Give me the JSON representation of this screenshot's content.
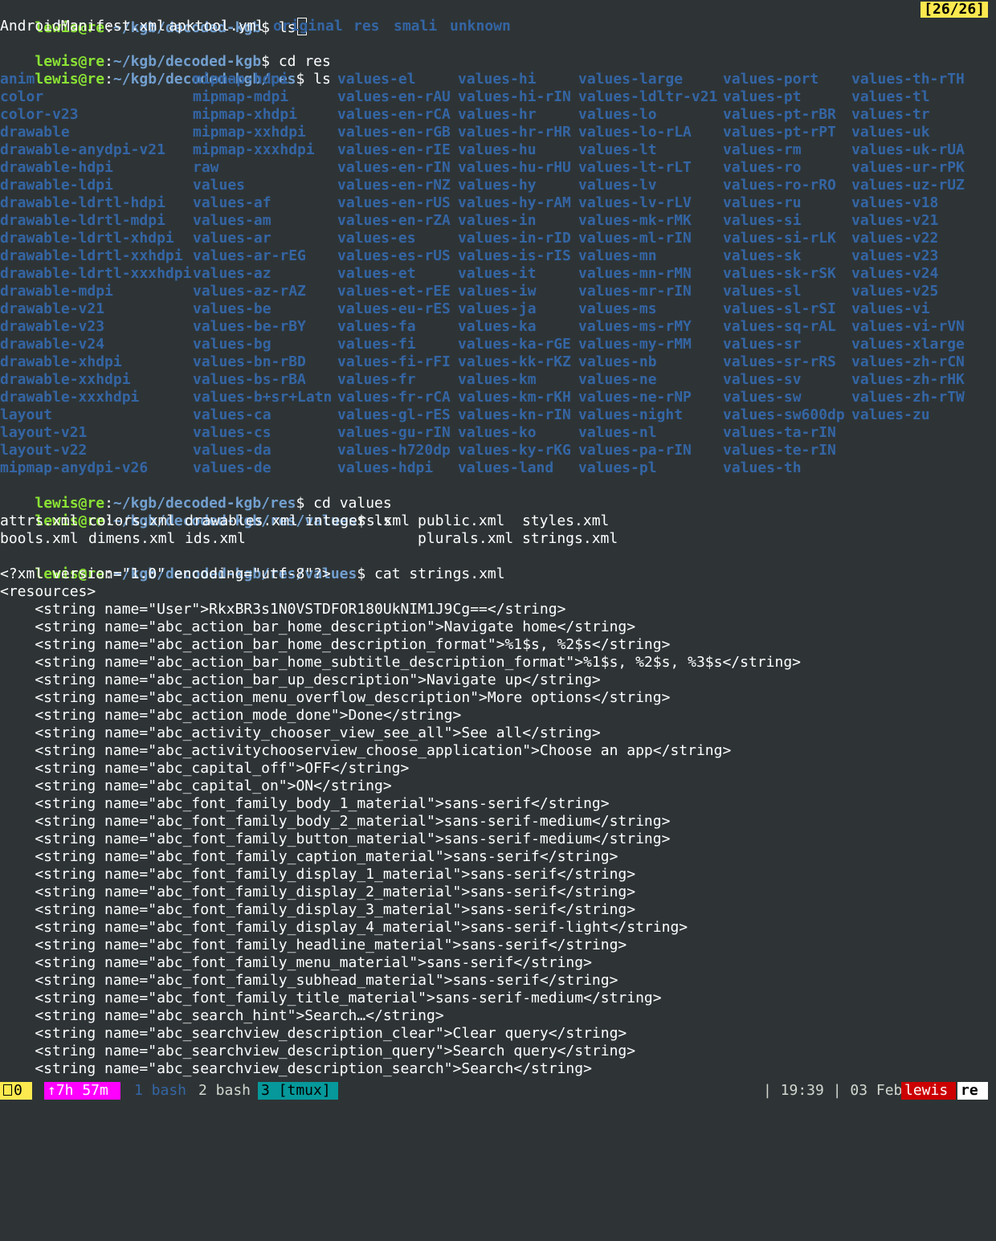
{
  "prompt": {
    "user": "lewis",
    "at": "@",
    "host": "re",
    "sep": ":",
    "path_home": "~/kgb/decoded-kgb",
    "path_res": "~/kgb/decoded-kgb/res",
    "path_values": "~/kgb/decoded-kgb/res/values",
    "dollar": "$"
  },
  "commands": {
    "ls1": " ls",
    "cd_res": " cd res",
    "ls2": " ls",
    "cd_values": " cd values",
    "ls3": " ls",
    "cat": " cat strings.xml"
  },
  "tmux_indicator": "[26/26]",
  "ls_root": {
    "files": [
      "AndroidManifest.xml",
      "apktool.yml"
    ],
    "dirs": [
      "original",
      "res",
      "smali",
      "unknown"
    ]
  },
  "res_columns": [
    [
      "anim",
      "color",
      "color-v23",
      "drawable",
      "drawable-anydpi-v21",
      "drawable-hdpi",
      "drawable-ldpi",
      "drawable-ldrtl-hdpi",
      "drawable-ldrtl-mdpi",
      "drawable-ldrtl-xhdpi",
      "drawable-ldrtl-xxhdpi",
      "drawable-ldrtl-xxxhdpi",
      "drawable-mdpi",
      "drawable-v21",
      "drawable-v23",
      "drawable-v24",
      "drawable-xhdpi",
      "drawable-xxhdpi",
      "drawable-xxxhdpi",
      "layout",
      "layout-v21",
      "layout-v22",
      "mipmap-anydpi-v26"
    ],
    [
      "mipmap-hdpi",
      "mipmap-mdpi",
      "mipmap-xhdpi",
      "mipmap-xxhdpi",
      "mipmap-xxxhdpi",
      "raw",
      "values",
      "values-af",
      "values-am",
      "values-ar",
      "values-ar-rEG",
      "values-az",
      "values-az-rAZ",
      "values-be",
      "values-be-rBY",
      "values-bg",
      "values-bn-rBD",
      "values-bs-rBA",
      "values-b+sr+Latn",
      "values-ca",
      "values-cs",
      "values-da",
      "values-de"
    ],
    [
      "values-el",
      "values-en-rAU",
      "values-en-rCA",
      "values-en-rGB",
      "values-en-rIE",
      "values-en-rIN",
      "values-en-rNZ",
      "values-en-rUS",
      "values-en-rZA",
      "values-es",
      "values-es-rUS",
      "values-et",
      "values-et-rEE",
      "values-eu-rES",
      "values-fa",
      "values-fi",
      "values-fi-rFI",
      "values-fr",
      "values-fr-rCA",
      "values-gl-rES",
      "values-gu-rIN",
      "values-h720dp",
      "values-hdpi"
    ],
    [
      "values-hi",
      "values-hi-rIN",
      "values-hr",
      "values-hr-rHR",
      "values-hu",
      "values-hu-rHU",
      "values-hy",
      "values-hy-rAM",
      "values-in",
      "values-in-rID",
      "values-is-rIS",
      "values-it",
      "values-iw",
      "values-ja",
      "values-ka",
      "values-ka-rGE",
      "values-kk-rKZ",
      "values-km",
      "values-km-rKH",
      "values-kn-rIN",
      "values-ko",
      "values-ky-rKG",
      "values-land"
    ],
    [
      "values-large",
      "values-ldltr-v21",
      "values-lo",
      "values-lo-rLA",
      "values-lt",
      "values-lt-rLT",
      "values-lv",
      "values-lv-rLV",
      "values-mk-rMK",
      "values-ml-rIN",
      "values-mn",
      "values-mn-rMN",
      "values-mr-rIN",
      "values-ms",
      "values-ms-rMY",
      "values-my-rMM",
      "values-nb",
      "values-ne",
      "values-ne-rNP",
      "values-night",
      "values-nl",
      "values-pa-rIN",
      "values-pl"
    ],
    [
      "values-port",
      "values-pt",
      "values-pt-rBR",
      "values-pt-rPT",
      "values-rm",
      "values-ro",
      "values-ro-rRO",
      "values-ru",
      "values-si",
      "values-si-rLK",
      "values-sk",
      "values-sk-rSK",
      "values-sl",
      "values-sl-rSI",
      "values-sq-rAL",
      "values-sr",
      "values-sr-rRS",
      "values-sv",
      "values-sw",
      "values-sw600dp",
      "values-ta-rIN",
      "values-te-rIN",
      "values-th"
    ],
    [
      "values-th-rTH",
      "values-tl",
      "values-tr",
      "values-uk",
      "values-uk-rUA",
      "values-ur-rPK",
      "values-uz-rUZ",
      "values-v18",
      "values-v21",
      "values-v22",
      "values-v23",
      "values-v24",
      "values-v25",
      "values-vi",
      "values-vi-rVN",
      "values-xlarge",
      "values-zh-rCN",
      "values-zh-rHK",
      "values-zh-rTW",
      "values-zu"
    ]
  ],
  "values_ls": {
    "row1": [
      "attrs.xml",
      "colors.xml",
      "drawables.xml",
      "integers.xml",
      "public.xml",
      "styles.xml"
    ],
    "row2": [
      "bools.xml",
      "dimens.xml",
      "ids.xml",
      "",
      "plurals.xml",
      "strings.xml"
    ]
  },
  "xml_lines": [
    "<?xml version=\"1.0\" encoding=\"utf-8\"?>",
    "<resources>",
    "    <string name=\"User\">RkxBR3s1N0VSTDFOR180UkNIM1J9Cg==</string>",
    "    <string name=\"abc_action_bar_home_description\">Navigate home</string>",
    "    <string name=\"abc_action_bar_home_description_format\">%1$s, %2$s</string>",
    "    <string name=\"abc_action_bar_home_subtitle_description_format\">%1$s, %2$s, %3$s</string>",
    "    <string name=\"abc_action_bar_up_description\">Navigate up</string>",
    "    <string name=\"abc_action_menu_overflow_description\">More options</string>",
    "    <string name=\"abc_action_mode_done\">Done</string>",
    "    <string name=\"abc_activity_chooser_view_see_all\">See all</string>",
    "    <string name=\"abc_activitychooserview_choose_application\">Choose an app</string>",
    "    <string name=\"abc_capital_off\">OFF</string>",
    "    <string name=\"abc_capital_on\">ON</string>",
    "    <string name=\"abc_font_family_body_1_material\">sans-serif</string>",
    "    <string name=\"abc_font_family_body_2_material\">sans-serif-medium</string>",
    "    <string name=\"abc_font_family_button_material\">sans-serif-medium</string>",
    "    <string name=\"abc_font_family_caption_material\">sans-serif</string>",
    "    <string name=\"abc_font_family_display_1_material\">sans-serif</string>",
    "    <string name=\"abc_font_family_display_2_material\">sans-serif</string>",
    "    <string name=\"abc_font_family_display_3_material\">sans-serif</string>",
    "    <string name=\"abc_font_family_display_4_material\">sans-serif-light</string>",
    "    <string name=\"abc_font_family_headline_material\">sans-serif</string>",
    "    <string name=\"abc_font_family_menu_material\">sans-serif</string>",
    "    <string name=\"abc_font_family_subhead_material\">sans-serif</string>",
    "    <string name=\"abc_font_family_title_material\">sans-serif-medium</string>",
    "    <string name=\"abc_search_hint\">Search…</string>",
    "    <string name=\"abc_searchview_description_clear\">Clear query</string>",
    "    <string name=\"abc_searchview_description_query\">Search query</string>",
    "    <string name=\"abc_searchview_description_search\">Search</string>"
  ],
  "statusbar": {
    "session": "0",
    "uptime": "↑7h 57m",
    "windows": [
      {
        "label": "1 bash",
        "active": false,
        "color": "#3465a4"
      },
      {
        "label": "2 bash",
        "active": false,
        "color": "#d3d7cf"
      },
      {
        "label": "3 [tmux]",
        "active": true,
        "color": "#000000"
      }
    ],
    "time": "| 19:39 | 03 Feb ",
    "user": "lewis",
    "host": "re"
  },
  "colors": {
    "background": "#2e3436",
    "prompt_user": "#8ae234",
    "prompt_path": "#729fcf",
    "directory": "#3465a4",
    "indicator_bg": "#fce94f",
    "session_bg": "#fce94f",
    "uptime_bg": "#ff00ff",
    "active_window_bg": "#06989a",
    "user_badge_bg": "#cc0000",
    "host_badge_bg": "#ffffff"
  }
}
